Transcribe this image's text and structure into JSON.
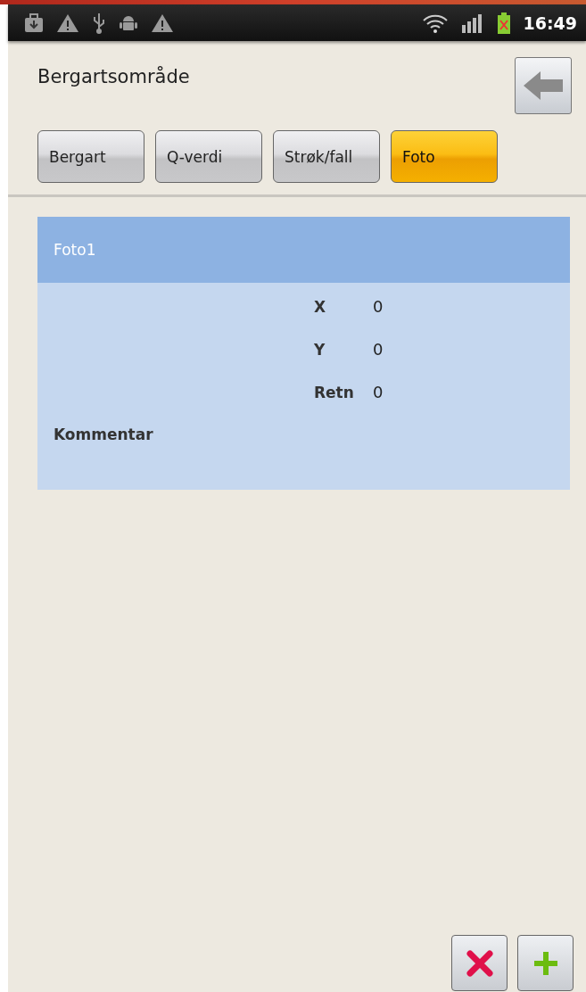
{
  "status_bar": {
    "time": "16:49"
  },
  "title": "Bergartsområde",
  "tabs": [
    {
      "label": "Bergart",
      "selected": false
    },
    {
      "label": "Q-verdi",
      "selected": false
    },
    {
      "label": "Strøk/fall",
      "selected": false
    },
    {
      "label": "Foto",
      "selected": true
    }
  ],
  "photo": {
    "name": "Foto1",
    "fields": [
      {
        "label": "X",
        "value": "0"
      },
      {
        "label": "Y",
        "value": "0"
      },
      {
        "label": "Retn",
        "value": "0"
      }
    ],
    "comment_label": "Kommentar"
  }
}
